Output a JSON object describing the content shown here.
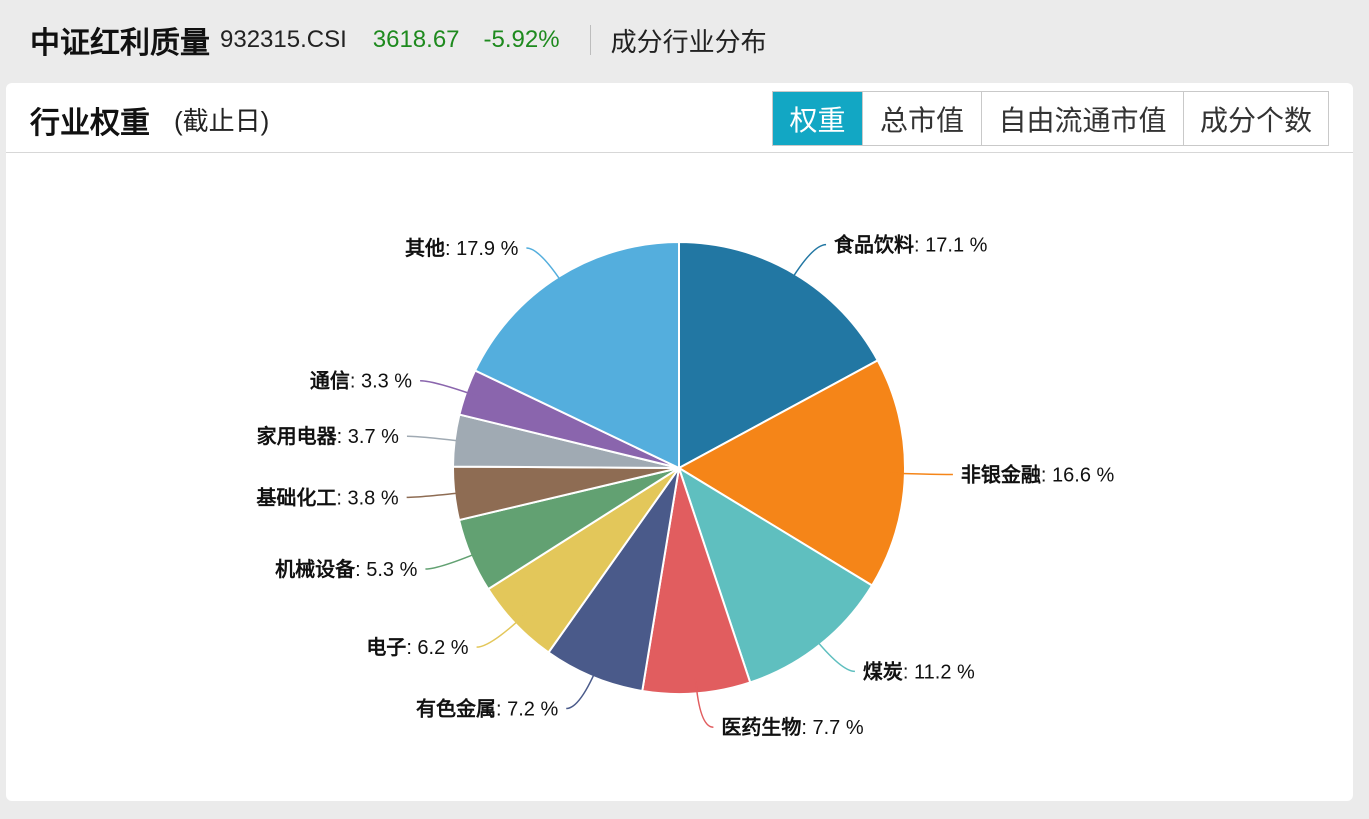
{
  "header": {
    "index_name": "中证红利质量",
    "index_code": "932315.CSI",
    "price": "3618.67",
    "change_pct": "-5.92%",
    "section_title": "成分行业分布",
    "up_down_color": "#1e8a1e"
  },
  "card": {
    "title": "行业权重",
    "subtitle": "(截止日)",
    "tabs": [
      {
        "label": "权重",
        "active": true
      },
      {
        "label": "总市值",
        "active": false
      },
      {
        "label": "自由流通市值",
        "active": false
      },
      {
        "label": "成分个数",
        "active": false
      }
    ],
    "accent_color": "#12a7c4"
  },
  "chart_data": {
    "type": "pie",
    "unit": "%",
    "slices": [
      {
        "name": "食品饮料",
        "value": 17.1,
        "color": "#2277a3"
      },
      {
        "name": "非银金融",
        "value": 16.6,
        "color": "#f58518"
      },
      {
        "name": "煤炭",
        "value": 11.2,
        "color": "#5fbfbf"
      },
      {
        "name": "医药生物",
        "value": 7.7,
        "color": "#e15d5f"
      },
      {
        "name": "有色金属",
        "value": 7.2,
        "color": "#4a5a8a"
      },
      {
        "name": "电子",
        "value": 6.2,
        "color": "#e3c75a"
      },
      {
        "name": "机械设备",
        "value": 5.3,
        "color": "#62a172"
      },
      {
        "name": "基础化工",
        "value": 3.8,
        "color": "#8e6c53"
      },
      {
        "name": "家用电器",
        "value": 3.7,
        "color": "#a0aab3"
      },
      {
        "name": "通信",
        "value": 3.3,
        "color": "#8a65ad"
      },
      {
        "name": "其他",
        "value": 17.9,
        "color": "#54aedd"
      }
    ]
  }
}
